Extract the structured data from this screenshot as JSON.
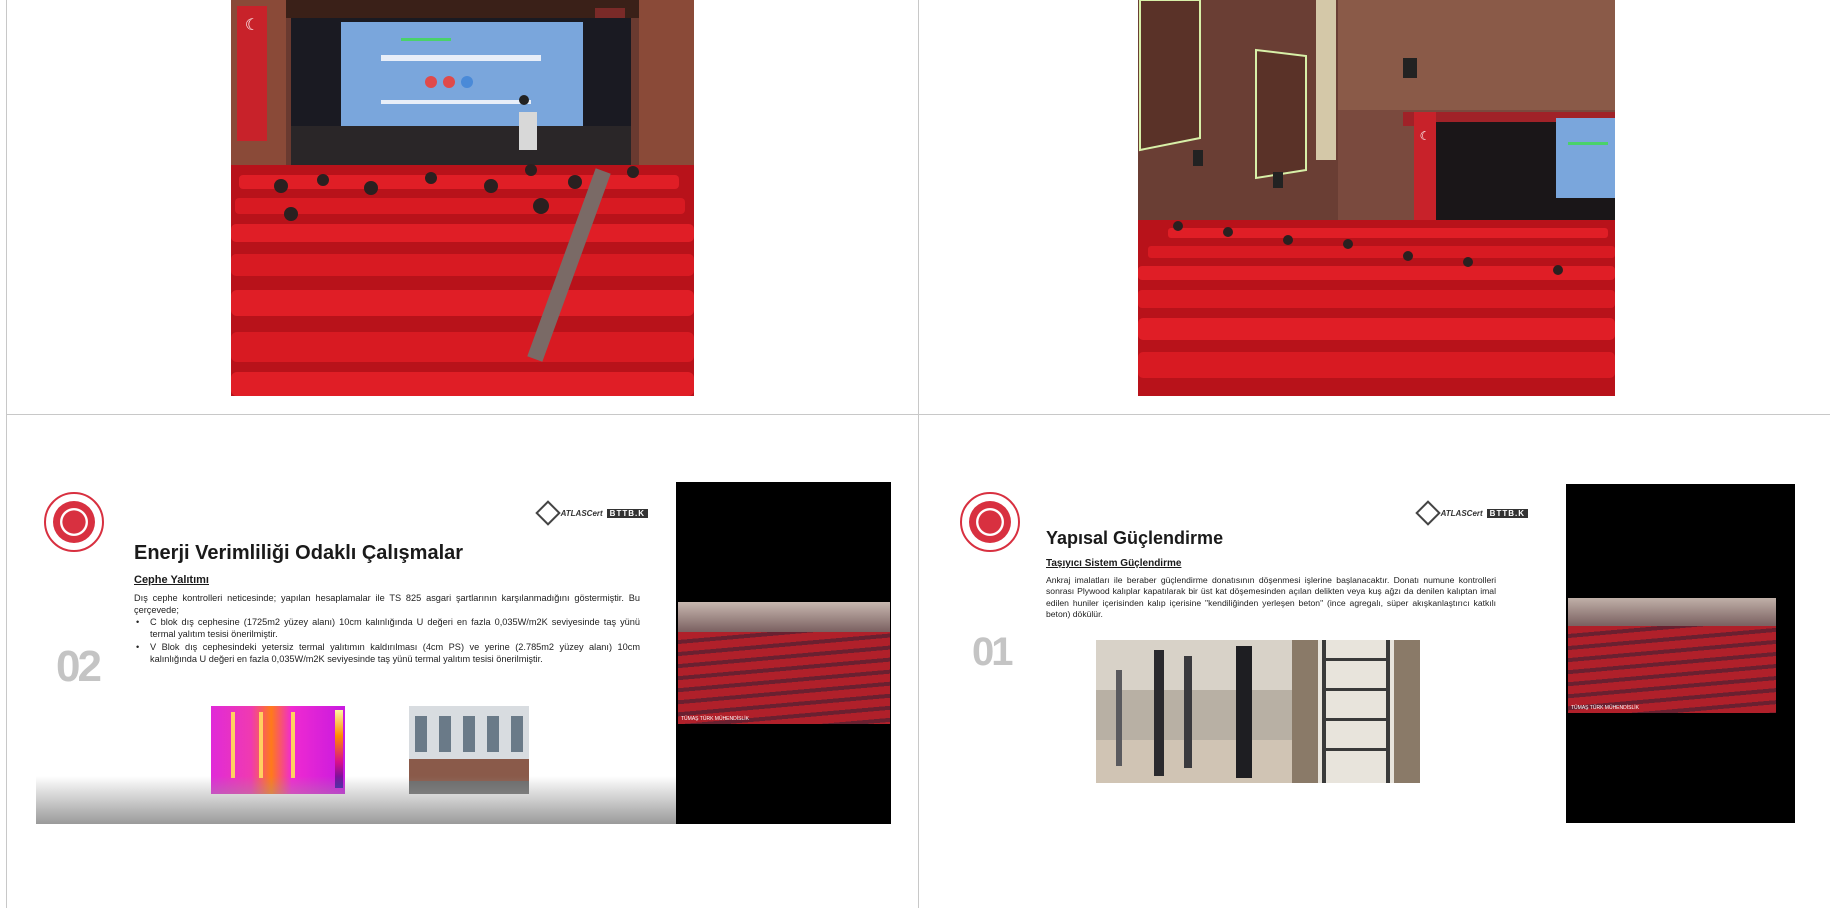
{
  "cells": {
    "top_left": {
      "kind": "photo",
      "content": "auditorium-stage-view"
    },
    "top_right": {
      "kind": "photo",
      "content": "auditorium-side-view"
    }
  },
  "slide_left": {
    "number": "02",
    "title": "Enerji Verimliliği Odaklı Çalışmalar",
    "subtitle": "Cephe Yalıtımı",
    "paragraph": "Dış cephe kontrolleri neticesinde; yapılan hesaplamalar ile TS 825 asgari şartlarının karşılanmadığını göstermiştir. Bu çerçevede;",
    "bullets": [
      "C blok dış cephesine (1725m2 yüzey alanı) 10cm kalınlığında U değeri en fazla 0,035W/m2K seviyesinde taş yünü termal yalıtım tesisi önerilmiştir.",
      "V Blok dış cephesindeki yetersiz termal yalıtımın kaldırılması (4cm PS) ve yerine (2.785m2 yüzey alanı) 10cm kalınlığında U değeri en fazla 0,035W/m2K seviyesinde taş yünü termal yalıtım tesisi önerilmiştir."
    ],
    "logo_text": "ATLASCert",
    "logo_bar": "BTTB.K",
    "cam_label": "TÜMAŞ TÜRK MÜHENDİSLİK"
  },
  "slide_right": {
    "number": "01",
    "title": "Yapısal Güçlendirme",
    "subtitle": "Taşıyıcı Sistem Güçlendirme",
    "paragraph": "Ankraj imalatları ile beraber güçlendirme donatısının döşenmesi işlerine başlanacaktır. Donatı numune kontrolleri sonrası Plywood kalıplar kapatılarak bir üst kat döşemesinden açılan delikten veya kuş ağzı da denilen kalıptan imal edilen huniler içerisinden kalıp içerisine \"kendiliğinden yerleşen beton\" (ince agregalı, süper akışkanlaştırıcı katkılı beton) dökülür.",
    "logo_text": "ATLASCert",
    "logo_bar": "BTTB.K",
    "cam_label": "TÜMAŞ TÜRK MÜHENDİSLİK"
  },
  "colors": {
    "seat_red": "#d41a22",
    "wall_brown": "#7a4a3a",
    "seal_red": "#d83040",
    "screen_blue": "#6a9ed8"
  }
}
